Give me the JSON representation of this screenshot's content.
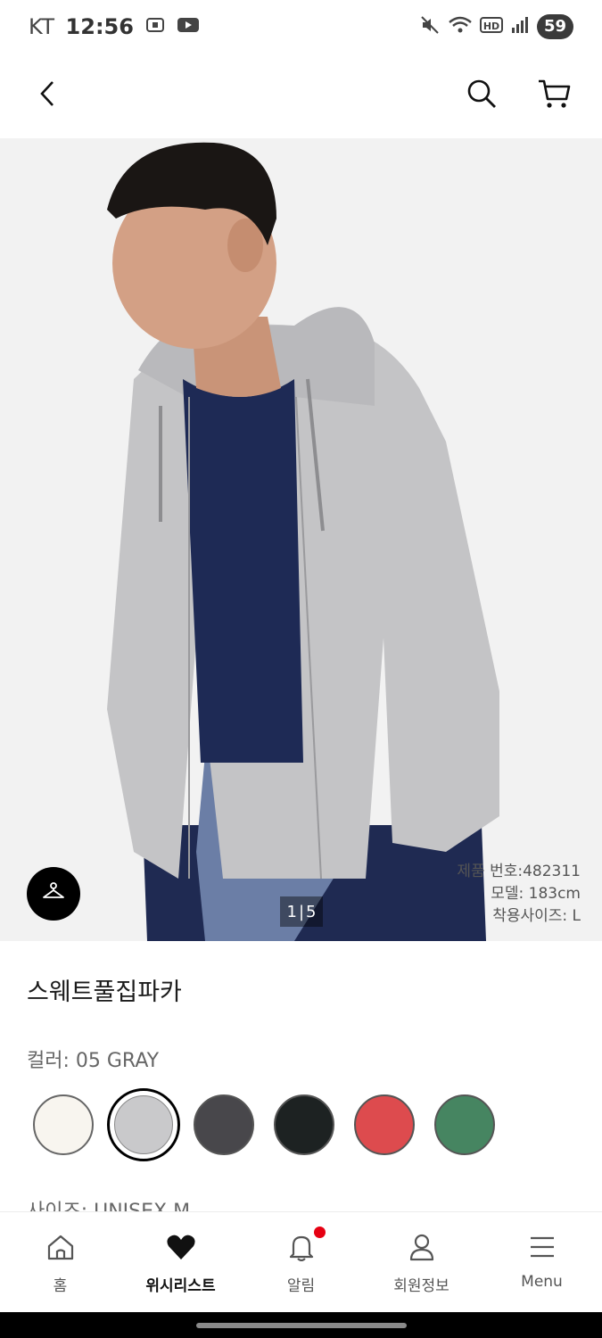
{
  "status_bar": {
    "carrier": "KT",
    "time": "12:56",
    "battery": "59",
    "icons": [
      "screenshot-icon",
      "youtube-icon",
      "mute-icon",
      "wifi-icon",
      "hd-icon",
      "signal-icon"
    ]
  },
  "header": {
    "back_icon": "chevron-left-icon",
    "search_icon": "search-icon",
    "cart_icon": "cart-icon"
  },
  "hero": {
    "description_items": [
      "제품 번호:482311",
      "모델: 183cm",
      "착용사이즈: L"
    ],
    "counter_current": "1",
    "counter_total": "5",
    "fit_icon": "hanger-icon"
  },
  "product": {
    "title": "스웨트풀집파카",
    "color_label": "컬러: 05 GRAY",
    "size_label": "사이즈: UNISEX M",
    "swatches": [
      {
        "name": "OFF WHITE",
        "color": "#f8f5ef",
        "selected": false
      },
      {
        "name": "GRAY",
        "color": "#c9c9cb",
        "selected": true
      },
      {
        "name": "DARK GRAY",
        "color": "#48474b",
        "selected": false
      },
      {
        "name": "BLACK",
        "color": "#1d2222",
        "selected": false
      },
      {
        "name": "RED",
        "color": "#dd4b4e",
        "selected": false
      },
      {
        "name": "GREEN",
        "color": "#468561",
        "selected": false
      }
    ]
  },
  "bottom_nav": {
    "items": [
      {
        "label": "홈",
        "icon": "home-icon",
        "active": false
      },
      {
        "label": "위시리스트",
        "icon": "heart-icon",
        "active": true
      },
      {
        "label": "알림",
        "icon": "bell-icon",
        "active": false,
        "badge": true
      },
      {
        "label": "회원정보",
        "icon": "user-icon",
        "active": false
      },
      {
        "label": "Menu",
        "icon": "menu-icon",
        "active": false
      }
    ]
  },
  "colors": {
    "accent": "#000000",
    "badge": "#e60012",
    "background": "#ffffff",
    "hero_background": "#f2f2f2"
  }
}
